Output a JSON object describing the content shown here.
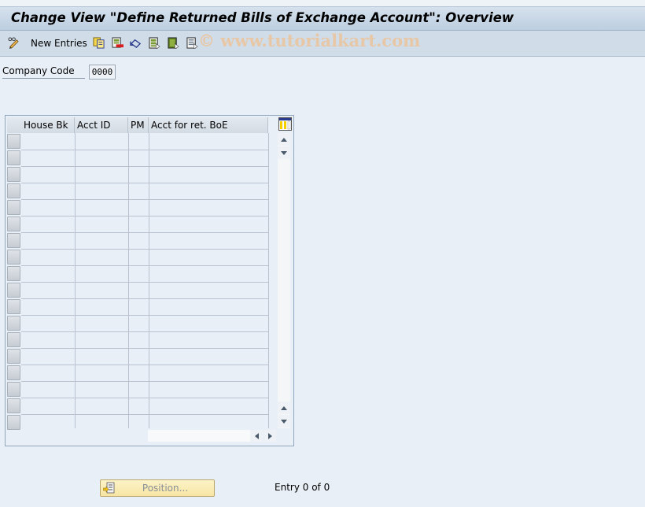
{
  "window": {
    "title": "Change View \"Define Returned Bills of Exchange Account\": Overview"
  },
  "toolbar": {
    "items": [
      {
        "name": "display-change-icon",
        "label": ""
      },
      {
        "name": "new-entries-button",
        "label": "New Entries"
      },
      {
        "name": "copy-as-icon",
        "label": ""
      },
      {
        "name": "delete-icon",
        "label": ""
      },
      {
        "name": "undo-change-icon",
        "label": ""
      },
      {
        "name": "select-all-icon",
        "label": ""
      },
      {
        "name": "select-block-icon",
        "label": ""
      },
      {
        "name": "deselect-all-icon",
        "label": ""
      }
    ],
    "new_entries_label": "New Entries"
  },
  "watermark": "© www.tutorialkart.com",
  "company_code": {
    "label": "Company Code",
    "value": "0000"
  },
  "table": {
    "columns": [
      "House Bk",
      "Acct ID",
      "PM",
      "Acct for ret. BoE"
    ],
    "row_count": 18,
    "rows": []
  },
  "footer": {
    "position_button": "Position...",
    "entry_status": "Entry 0 of 0"
  },
  "colors": {
    "background": "#e9eff6",
    "titlebar": "#c8d7e6",
    "toolbar": "#d0dce8",
    "watermark": "#ecc49a",
    "position_button": "#f6e5a3"
  }
}
